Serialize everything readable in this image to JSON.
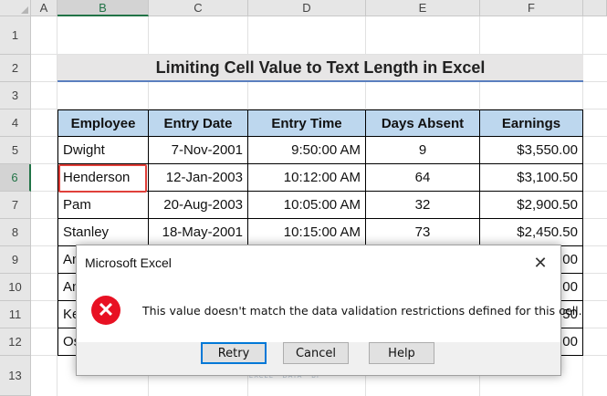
{
  "sheet": {
    "columns": [
      "A",
      "B",
      "C",
      "D",
      "E",
      "F"
    ],
    "rows": [
      "1",
      "2",
      "3",
      "4",
      "5",
      "6",
      "7",
      "8",
      "9",
      "10",
      "11",
      "12",
      "13"
    ],
    "title": "Limiting Cell Value to Text Length in Excel",
    "selected_column": "B",
    "selected_row": "6"
  },
  "table": {
    "headers": [
      "Employee",
      "Entry Date",
      "Entry Time",
      "Days Absent",
      "Earnings"
    ],
    "rows": [
      [
        "Dwight",
        "7-Nov-2001",
        "9:50:00 AM",
        "9",
        "$3,550.00"
      ],
      [
        "Henderson",
        "12-Jan-2003",
        "10:12:00 AM",
        "64",
        "$3,100.50"
      ],
      [
        "Pam",
        "20-Aug-2003",
        "10:05:00 AM",
        "32",
        "$2,900.50"
      ],
      [
        "Stanley",
        "18-May-2001",
        "10:15:00 AM",
        "73",
        "$2,450.50"
      ],
      [
        "An",
        "",
        "",
        "",
        ".00"
      ],
      [
        "An",
        "",
        "",
        "",
        ".00"
      ],
      [
        "Ke",
        "",
        "",
        "",
        ".50"
      ],
      [
        "Os",
        "",
        "",
        "",
        ".00"
      ]
    ]
  },
  "dialog": {
    "title": "Microsoft Excel",
    "close_glyph": "✕",
    "icon": "error-x-icon",
    "icon_glyph": "✕",
    "message": "This value doesn't match the data validation restrictions defined for this cell.",
    "buttons": {
      "retry": "Retry",
      "cancel": "Cancel",
      "help": "Help"
    }
  },
  "watermark": {
    "name": "exceldemy",
    "tagline": "EXCEL · DATA · BI"
  },
  "colors": {
    "header_fill": "#bdd7ee",
    "title_underline": "#5b7fbf",
    "active_cell_border": "#e0403a",
    "error_red": "#e81123",
    "default_button_border": "#0078d7"
  }
}
